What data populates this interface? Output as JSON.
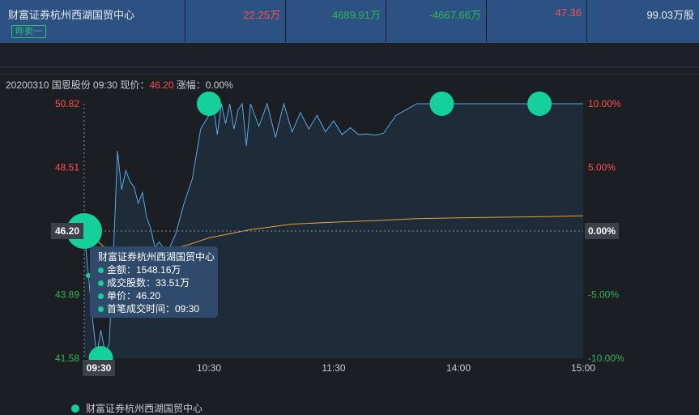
{
  "top_row": {
    "name": "财富证券杭州西湖国贸中心",
    "tag": "昨卖一",
    "cells": [
      {
        "value": "22.25万",
        "color": "red"
      },
      {
        "value": "4689.91万",
        "color": "green"
      },
      {
        "value": "-4667.66万",
        "color": "green"
      },
      {
        "value": "47.36",
        "color": "red"
      },
      {
        "value": "99.03万股",
        "color": "white"
      }
    ]
  },
  "header": {
    "prefix": "20200310 国恩股份 09:30 现价：",
    "price": "46.20",
    "suffix": " 涨幅：0.00%"
  },
  "tooltip": {
    "title": "财富证券杭州西湖国贸中心",
    "amount": "金额：1548.16万",
    "shares": "成交股数：33.51万",
    "unit_price": "单价：46.20",
    "first_time": "首笔成交时间：09:30"
  },
  "legend": {
    "label": "财富证券杭州西湖国贸中心"
  },
  "colors": {
    "price_line": "#5aa9e6",
    "avg_line": "#e6a23c",
    "bubble": "#14d19c",
    "up": "#ff4d4f",
    "down": "#2fb559"
  },
  "chart_data": {
    "type": "line",
    "prev_close": 46.2,
    "ylim": [
      41.58,
      50.82
    ],
    "y_ticks_left": [
      "50.82",
      "48.51",
      "46.20",
      "43.89",
      "41.58"
    ],
    "y_ticks_right": [
      "10.00%",
      "5.00%",
      "0.00%",
      "-5.00%",
      "-10.00%"
    ],
    "x_ticks": [
      "09:30",
      "10:30",
      "11:30",
      "14:00",
      "15:00"
    ],
    "crosshair": {
      "time": "09:30",
      "price": "46.20",
      "pct": "0.00%"
    },
    "series": [
      {
        "name": "price",
        "x": [
          0,
          2,
          4,
          6,
          8,
          10,
          12,
          14,
          16,
          18,
          20,
          22,
          24,
          26,
          28,
          30,
          32,
          34,
          36,
          40,
          44,
          48,
          52,
          56,
          60,
          62,
          64,
          66,
          68,
          70,
          72,
          74,
          76,
          78,
          80,
          84,
          88,
          92,
          96,
          100,
          104,
          108,
          112,
          116,
          120,
          124,
          128,
          132,
          136,
          140,
          144,
          150,
          160,
          170,
          180,
          190,
          200,
          210,
          220,
          230,
          240
        ],
        "y": [
          46.2,
          44.6,
          43.0,
          41.7,
          42.6,
          41.8,
          42.1,
          45.3,
          49.1,
          47.7,
          48.4,
          48.0,
          47.8,
          47.2,
          47.6,
          46.7,
          46.3,
          45.6,
          45.8,
          45.4,
          46.1,
          47.2,
          48.1,
          49.9,
          50.4,
          50.82,
          49.7,
          50.82,
          50.1,
          50.82,
          49.9,
          50.6,
          50.82,
          49.3,
          50.82,
          50.0,
          50.82,
          49.6,
          50.82,
          49.8,
          50.5,
          49.9,
          50.4,
          49.8,
          50.2,
          49.7,
          49.95,
          49.7,
          49.72,
          49.68,
          49.75,
          50.4,
          50.82,
          50.82,
          50.82,
          50.82,
          50.82,
          50.82,
          50.82,
          50.82,
          50.82
        ]
      },
      {
        "name": "avg",
        "x": [
          0,
          10,
          20,
          30,
          40,
          50,
          60,
          70,
          80,
          90,
          100,
          120,
          140,
          160,
          180,
          200,
          220,
          240
        ],
        "y": [
          46.2,
          45.6,
          45.5,
          45.3,
          45.5,
          45.7,
          45.95,
          46.1,
          46.25,
          46.35,
          46.45,
          46.52,
          46.58,
          46.65,
          46.68,
          46.7,
          46.72,
          46.75
        ]
      }
    ],
    "markers": [
      {
        "x": 0,
        "y": 46.2,
        "size": "large"
      },
      {
        "x": 8,
        "y": 41.58,
        "size": "medium"
      },
      {
        "x": 60,
        "y": 50.82,
        "size": "medium"
      },
      {
        "x": 172,
        "y": 50.82,
        "size": "medium"
      },
      {
        "x": 219,
        "y": 50.82,
        "size": "medium"
      }
    ]
  }
}
